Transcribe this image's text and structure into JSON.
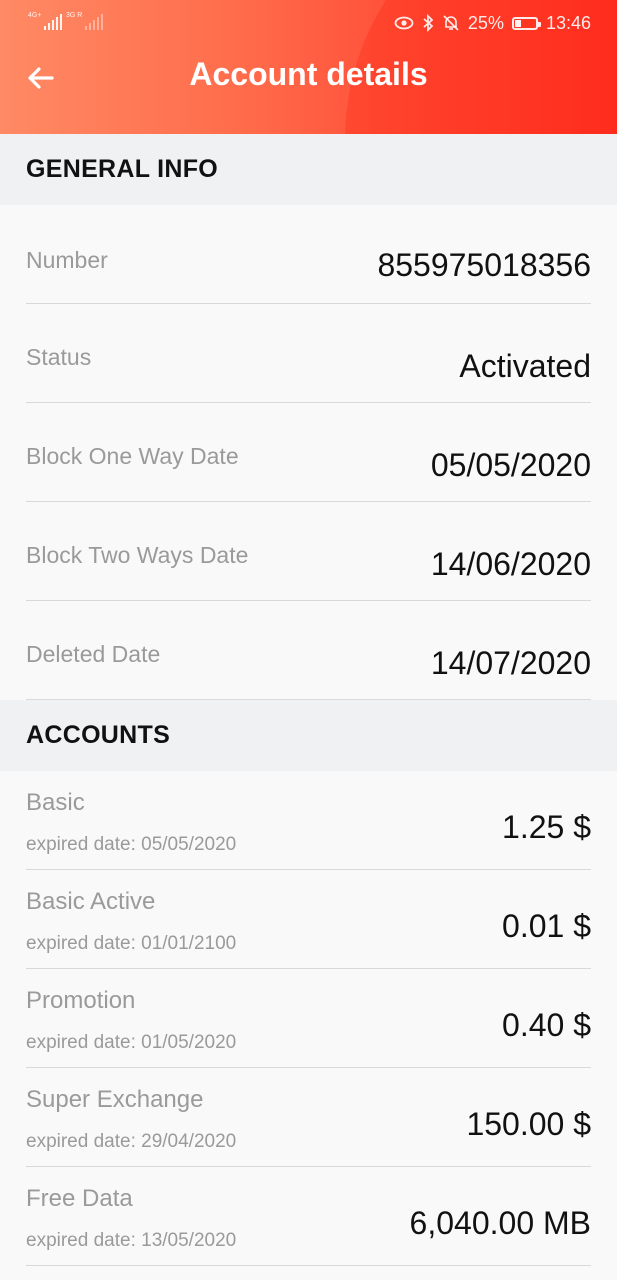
{
  "status_bar": {
    "signal1_tag": "4G+",
    "signal2_tag": "3G R",
    "battery": "25%",
    "time": "13:46"
  },
  "header": {
    "title": "Account details",
    "back_icon": "arrow-left-icon"
  },
  "general_info": {
    "heading": "GENERAL INFO",
    "rows": [
      {
        "label": "Number",
        "value": "855975018356"
      },
      {
        "label": "Status",
        "value": "Activated"
      },
      {
        "label": "Block One Way Date",
        "value": "05/05/2020"
      },
      {
        "label": "Block Two Ways Date",
        "value": "14/06/2020"
      },
      {
        "label": "Deleted Date",
        "value": "14/07/2020"
      }
    ]
  },
  "accounts": {
    "heading": "ACCOUNTS",
    "items": [
      {
        "name": "Basic",
        "expiry": "expired date: 05/05/2020",
        "amount": "1.25 $"
      },
      {
        "name": "Basic Active",
        "expiry": "expired date: 01/01/2100",
        "amount": "0.01 $"
      },
      {
        "name": "Promotion",
        "expiry": "expired date: 01/05/2020",
        "amount": "0.40 $"
      },
      {
        "name": "Super Exchange",
        "expiry": "expired date: 29/04/2020",
        "amount": "150.00 $"
      },
      {
        "name": "Free Data",
        "expiry": "expired date: 13/05/2020",
        "amount": "6,040.00 MB"
      }
    ]
  },
  "colors": {
    "header_start": "#ff8a65",
    "header_end": "#ff2f22",
    "section_bg": "#f0f1f3",
    "label_gray": "#9a9a9a"
  }
}
